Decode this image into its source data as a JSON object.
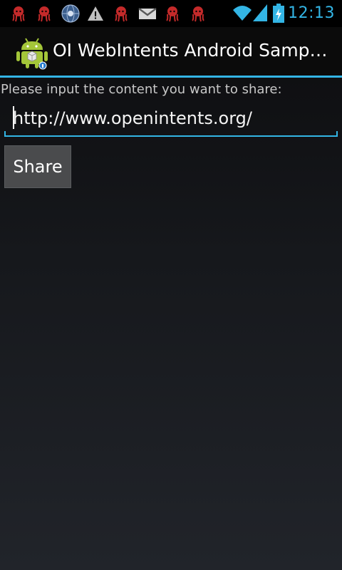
{
  "status_bar": {
    "time": "12:13",
    "icons": [
      "notification-octocat-icon",
      "notification-octocat-icon",
      "notification-globe-icon",
      "notification-warning-icon",
      "notification-octocat-icon",
      "notification-gmail-icon",
      "notification-octocat-icon",
      "notification-octocat-icon",
      "wifi-icon",
      "signal-icon",
      "battery-charging-icon"
    ],
    "accent_color": "#33b5e5"
  },
  "action_bar": {
    "title": "OI WebIntents Android Sample…",
    "icon": "android-app-icon"
  },
  "main": {
    "prompt": "Please input the content you want to share:",
    "input_value": "http://www.openintents.org/",
    "share_button_label": "Share"
  }
}
